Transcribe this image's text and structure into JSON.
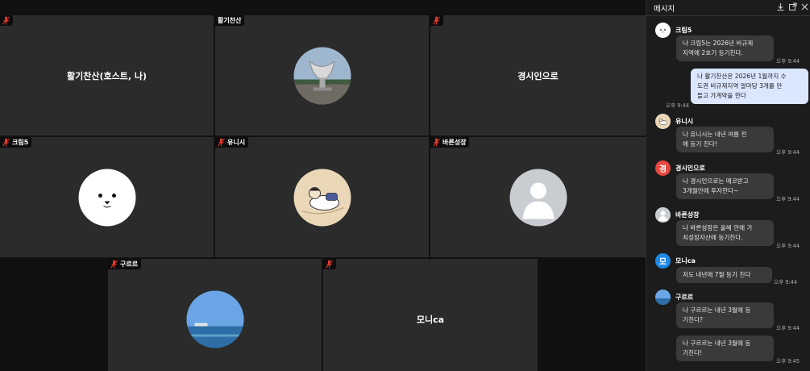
{
  "participants": {
    "host": {
      "name": "활기찬산(호스트, 나)"
    },
    "hwalgi": {
      "tag": "활기찬산"
    },
    "gyeongsi": {
      "name": "경시인으로"
    },
    "krim": {
      "tag": "크림5"
    },
    "yunisi": {
      "tag": "유니시"
    },
    "bareun": {
      "tag": "바른성장"
    },
    "gureure": {
      "tag": "구르르"
    },
    "moni": {
      "name": "모니ca"
    }
  },
  "chat": {
    "title": "메시지",
    "messages": [
      {
        "sender": "크림5",
        "text": [
          "나 크림5는 2026년 비규제",
          "지역에 2호기 등기친다."
        ],
        "time": "오후 9:44"
      },
      {
        "mine": true,
        "text": [
          "나 활기찬산은 2026년 1월까지 수",
          "도권 비규제지역 알마당 3개를 만",
          "들고 가계약을 한다"
        ],
        "time": "오후 9:44"
      },
      {
        "sender": "유니시",
        "text": [
          "나 유니시는 내년 여름 전",
          "에 등기 친다!"
        ],
        "time": "오후 9:44"
      },
      {
        "sender": "경시인으로",
        "avatar_letter": "경",
        "text": [
          "나 경시인으로는 매코받고",
          "3개월안에 투자한다~"
        ],
        "time": "오후 9:44"
      },
      {
        "sender": "바른성장",
        "text": [
          "나 바른성장은 올해 안에 가",
          "치성장자산에 등기친다."
        ],
        "time": "오후 9:44"
      },
      {
        "sender": "모니ca",
        "avatar_letter": "모",
        "text": [
          "저도 내년에 7월  등기 친다"
        ],
        "time": "오후 9:44"
      },
      {
        "sender": "구르르",
        "text": [
          "나 구르르는 내년 3월에 등",
          "기친다?"
        ],
        "time": "오후 9:44"
      },
      {
        "text": [
          "나 구르르는 내년 3월에 등",
          "기친다!"
        ],
        "time": "오후 9:45"
      }
    ]
  },
  "colors": {
    "tile_bg": "#2b2b2b",
    "chat_bg": "#1c1c1c",
    "bubble_other": "#3a3a3a",
    "bubble_mine": "#dbe6ff",
    "mic_muted": "#e0392b",
    "gyeongsi_avatar": "#e8483f",
    "moni_avatar": "#1e88e5"
  }
}
